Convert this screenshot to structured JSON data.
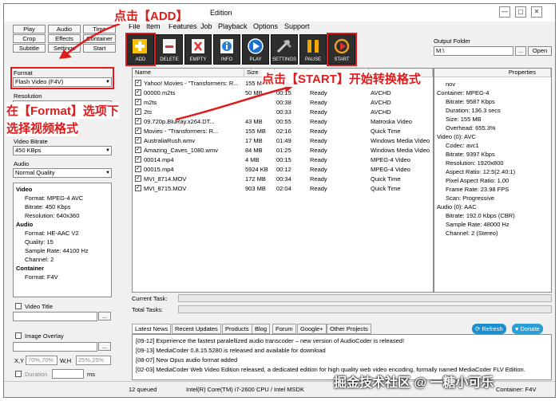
{
  "window": {
    "title": "Edition",
    "minimize": "—",
    "maximize": "▢",
    "close": "✕"
  },
  "menu": [
    "File",
    "Item",
    "Features",
    "Job",
    "Playback",
    "Options",
    "Support"
  ],
  "left_buttons": [
    "Play",
    "Audio",
    "Time",
    "Crop",
    "Effects",
    "Container",
    "Subtitle",
    "Settings",
    "Start"
  ],
  "left": {
    "format_label": "Format",
    "format_value": "Flash Video (F4V)",
    "resolution_label": "Resolution",
    "video_bitrate_label": "Video Bitrate",
    "video_bitrate_value": "450 KBps",
    "audio_label": "Audio",
    "audio_value": "Normal Quality",
    "video_title_label": "Video Title",
    "image_overlay_label": "Image Overlay",
    "xy_label": "X,Y",
    "xy_value": "70%,70%",
    "wh_label": "W,H",
    "wh_value": "25%,25%",
    "duration_label": "Duration",
    "ms_label": "ms",
    "browse": "..."
  },
  "summary": [
    {
      "text": "Video",
      "bold": true
    },
    {
      "text": "Format: MPEG-4 AVC",
      "bold": false
    },
    {
      "text": "Bitrate: 450 Kbps",
      "bold": false
    },
    {
      "text": "Resolution: 640x360",
      "bold": false
    },
    {
      "text": "Audio",
      "bold": true
    },
    {
      "text": "Format: HE-AAC V2",
      "bold": false
    },
    {
      "text": "Quality: 15",
      "bold": false
    },
    {
      "text": "Sample Rate: 44100 Hz",
      "bold": false
    },
    {
      "text": "Channel: 2",
      "bold": false
    },
    {
      "text": "Container",
      "bold": true
    },
    {
      "text": "Format: F4V",
      "bold": false
    }
  ],
  "toolbar": [
    {
      "label": "ADD",
      "icon": "add-icon"
    },
    {
      "label": "DELETE",
      "icon": "delete-icon"
    },
    {
      "label": "EMPTY",
      "icon": "empty-icon"
    },
    {
      "label": "INFO",
      "icon": "info-icon"
    },
    {
      "label": "PLAY",
      "icon": "play-icon"
    },
    {
      "label": "SETTINGS",
      "icon": "settings-icon"
    },
    {
      "label": "PAUSE",
      "icon": "pause-icon"
    },
    {
      "label": "START",
      "icon": "start-icon"
    }
  ],
  "output": {
    "label": "Output Folder",
    "value": "M:\\",
    "browse": "...",
    "open": "Open"
  },
  "file_columns": [
    "Name",
    "Size",
    "",
    "",
    ""
  ],
  "files": [
    {
      "name": "Yahoo! Movies - \"Transformers: R...",
      "size": "155 MB",
      "dur": "",
      "state": "",
      "fmt": ""
    },
    {
      "name": "00000.m2ts",
      "size": "50 MB",
      "dur": "00:15",
      "state": "Ready",
      "fmt": "AVCHD"
    },
    {
      "name": "m2ts",
      "size": "",
      "dur": "00:38",
      "state": "Ready",
      "fmt": "AVCHD"
    },
    {
      "name": "2ts",
      "size": "",
      "dur": "00:33",
      "state": "Ready",
      "fmt": "AVCHD"
    },
    {
      "name": "09.720p.BluRay.x264.DT...",
      "size": "43 MB",
      "dur": "00:55",
      "state": "Ready",
      "fmt": "Matroska Video"
    },
    {
      "name": "Movies - \"Transformers: R...",
      "size": "155 MB",
      "dur": "02:16",
      "state": "Ready",
      "fmt": "Quick Time"
    },
    {
      "name": "AustraliaRush.wmv",
      "size": "17 MB",
      "dur": "01:49",
      "state": "Ready",
      "fmt": "Windows Media Video"
    },
    {
      "name": "Amazing_Caves_1080.wmv",
      "size": "84 MB",
      "dur": "01:25",
      "state": "Ready",
      "fmt": "Windows Media Video"
    },
    {
      "name": "00014.mp4",
      "size": "4 MB",
      "dur": "00:15",
      "state": "Ready",
      "fmt": "MPEG-4 Video"
    },
    {
      "name": "00015.mp4",
      "size": "5924 KB",
      "dur": "00:12",
      "state": "Ready",
      "fmt": "MPEG-4 Video"
    },
    {
      "name": "MVI_8714.MOV",
      "size": "172 MB",
      "dur": "00:34",
      "state": "Ready",
      "fmt": "Quick Time"
    },
    {
      "name": "MVI_8715.MOV",
      "size": "903 MB",
      "dur": "02:04",
      "state": "Ready",
      "fmt": "Quick Time"
    }
  ],
  "props": {
    "header": "Properties",
    "lines": [
      {
        "text": "nov",
        "indent": 1
      },
      {
        "text": "Container: MPEG-4",
        "indent": 0
      },
      {
        "text": "Bitrate: 9587 Kbps",
        "indent": 1
      },
      {
        "text": "Duration: 136.3 secs",
        "indent": 1
      },
      {
        "text": "Size: 155 MB",
        "indent": 1
      },
      {
        "text": "Overhead: 655.3%",
        "indent": 1
      },
      {
        "text": "Video (0): AVC",
        "indent": 0
      },
      {
        "text": "Codec: avc1",
        "indent": 1
      },
      {
        "text": "Bitrate: 9397 Kbps",
        "indent": 1
      },
      {
        "text": "Resolution: 1920x800",
        "indent": 1
      },
      {
        "text": "Aspect Ratio: 12:5(2.40:1)",
        "indent": 1
      },
      {
        "text": "Pixel Aspect Ratio: 1.00",
        "indent": 1
      },
      {
        "text": "Frame Rate: 23.98 FPS",
        "indent": 1
      },
      {
        "text": "Scan: Progressive",
        "indent": 1
      },
      {
        "text": "Audio (0): AAC",
        "indent": 0
      },
      {
        "text": "Bitrate: 192.0 Kbps (CBR)",
        "indent": 1
      },
      {
        "text": "Sample Rate: 48000 Hz",
        "indent": 1
      },
      {
        "text": "Channel: 2 (Stereo)",
        "indent": 1
      }
    ]
  },
  "tasks": {
    "current_label": "Current Task:",
    "total_label": "Total Tasks:"
  },
  "news_tabs": [
    "Latest News",
    "Recent Updates",
    "Products",
    "Blog",
    "Forum",
    "Google+",
    "Other Projects"
  ],
  "refresh": "Refresh",
  "donate": "Donate",
  "news": [
    "[09-12] Experience the fastest paralellized audio transcoder – new version of AudioCoder is released!",
    "[09-13] MediaCoder 0.8.15.5280 is released and available for download",
    "[08-07] New Opus audio format added",
    "[02-03] MediaCoder Web Video Edition released, a dedicated edition for high quality web video encoding, formally named MediaCoder FLV Edition."
  ],
  "status": {
    "queued": "12 queued",
    "cpu": "Intel(R) Core(TM) i7-2600 CPU  /  Intel MSDK",
    "container": "Container: F4V"
  },
  "annotations": {
    "add": "点击【ADD】",
    "format_line1": "在【Format】选项下",
    "format_line2": "选择视频格式",
    "start": "点击【START】开始转换格式"
  },
  "watermark": "掘金技术社区 @ 一糖小可乐",
  "colors": {
    "annotation": "#e01b1b",
    "toolbar": "#2e2e2e",
    "accent": "#1d8fd1"
  }
}
